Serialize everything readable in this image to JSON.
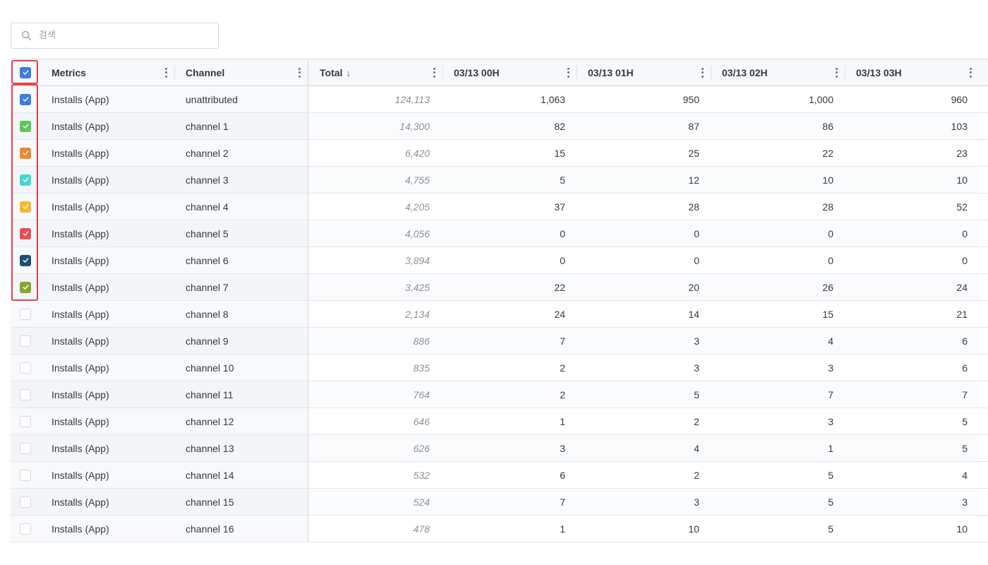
{
  "search": {
    "placeholder": "검색"
  },
  "colors": {
    "accent": "#2f6fe4",
    "highlight": "#e8424a"
  },
  "header": {
    "metrics": "Metrics",
    "channel": "Channel",
    "total": "Total",
    "sort_icon": "↓",
    "hours": [
      "03/13 00H",
      "03/13 01H",
      "03/13 02H",
      "03/13 03H"
    ]
  },
  "rows": [
    {
      "metric": "Installs (App)",
      "channel": "unattributed",
      "total": "124,113",
      "values": [
        "1,063",
        "950",
        "1,000",
        "960"
      ],
      "checked": true,
      "color": "#3d7be8"
    },
    {
      "metric": "Installs (App)",
      "channel": "channel 1",
      "total": "14,300",
      "values": [
        "82",
        "87",
        "86",
        "103"
      ],
      "checked": true,
      "color": "#5cc65a"
    },
    {
      "metric": "Installs (App)",
      "channel": "channel 2",
      "total": "6,420",
      "values": [
        "15",
        "25",
        "22",
        "23"
      ],
      "checked": true,
      "color": "#f5862f"
    },
    {
      "metric": "Installs (App)",
      "channel": "channel 3",
      "total": "4,755",
      "values": [
        "5",
        "12",
        "10",
        "10"
      ],
      "checked": true,
      "color": "#4bd6cf"
    },
    {
      "metric": "Installs (App)",
      "channel": "channel 4",
      "total": "4,205",
      "values": [
        "37",
        "28",
        "28",
        "52"
      ],
      "checked": true,
      "color": "#f7b731"
    },
    {
      "metric": "Installs (App)",
      "channel": "channel 5",
      "total": "4,056",
      "values": [
        "0",
        "0",
        "0",
        "0"
      ],
      "checked": true,
      "color": "#ee4a55"
    },
    {
      "metric": "Installs (App)",
      "channel": "channel 6",
      "total": "3,894",
      "values": [
        "0",
        "0",
        "0",
        "0"
      ],
      "checked": true,
      "color": "#1f4e72"
    },
    {
      "metric": "Installs (App)",
      "channel": "channel 7",
      "total": "3,425",
      "values": [
        "22",
        "20",
        "26",
        "24"
      ],
      "checked": true,
      "color": "#83a631"
    },
    {
      "metric": "Installs (App)",
      "channel": "channel 8",
      "total": "2,134",
      "values": [
        "24",
        "14",
        "15",
        "21"
      ],
      "checked": false,
      "color": ""
    },
    {
      "metric": "Installs (App)",
      "channel": "channel 9",
      "total": "886",
      "values": [
        "7",
        "3",
        "4",
        "6"
      ],
      "checked": false,
      "color": ""
    },
    {
      "metric": "Installs (App)",
      "channel": "channel 10",
      "total": "835",
      "values": [
        "2",
        "3",
        "3",
        "6"
      ],
      "checked": false,
      "color": ""
    },
    {
      "metric": "Installs (App)",
      "channel": "channel 11",
      "total": "764",
      "values": [
        "2",
        "5",
        "7",
        "7"
      ],
      "checked": false,
      "color": ""
    },
    {
      "metric": "Installs (App)",
      "channel": "channel 12",
      "total": "646",
      "values": [
        "1",
        "2",
        "3",
        "5"
      ],
      "checked": false,
      "color": ""
    },
    {
      "metric": "Installs (App)",
      "channel": "channel 13",
      "total": "626",
      "values": [
        "3",
        "4",
        "1",
        "5"
      ],
      "checked": false,
      "color": ""
    },
    {
      "metric": "Installs (App)",
      "channel": "channel 14",
      "total": "532",
      "values": [
        "6",
        "2",
        "5",
        "4"
      ],
      "checked": false,
      "color": ""
    },
    {
      "metric": "Installs (App)",
      "channel": "channel 15",
      "total": "524",
      "values": [
        "7",
        "3",
        "5",
        "3"
      ],
      "checked": false,
      "color": ""
    },
    {
      "metric": "Installs (App)",
      "channel": "channel 16",
      "total": "478",
      "values": [
        "1",
        "10",
        "5",
        "10"
      ],
      "checked": false,
      "color": ""
    }
  ]
}
